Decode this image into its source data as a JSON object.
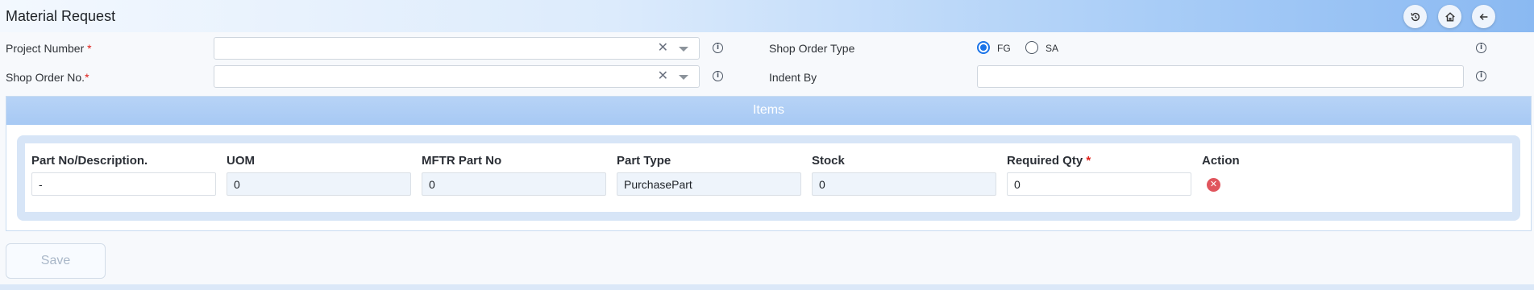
{
  "page": {
    "title": "Material Request",
    "header_icons": [
      "history-icon",
      "home-icon",
      "back-arrow-icon"
    ]
  },
  "form": {
    "project_number": {
      "label": "Project Number",
      "required_mark": "*",
      "value": ""
    },
    "shop_order_no": {
      "label": "Shop Order No.",
      "required_mark": "*",
      "value": ""
    },
    "shop_order_type": {
      "label": "Shop Order Type",
      "options": [
        {
          "label": "FG",
          "selected": true
        },
        {
          "label": "SA",
          "selected": false
        }
      ]
    },
    "indent_by": {
      "label": "Indent By",
      "value": ""
    }
  },
  "items": {
    "section_title": "Items",
    "columns": [
      {
        "label": "Part No/Description.",
        "required_mark": ""
      },
      {
        "label": "UOM",
        "required_mark": ""
      },
      {
        "label": "MFTR Part No",
        "required_mark": ""
      },
      {
        "label": "Part Type",
        "required_mark": ""
      },
      {
        "label": "Stock",
        "required_mark": ""
      },
      {
        "label": "Required Qty",
        "required_mark": "*"
      },
      {
        "label": "Action",
        "required_mark": ""
      }
    ],
    "rows": [
      {
        "part_no": "-",
        "uom": "0",
        "mftr_part_no": "0",
        "part_type": "PurchasePart",
        "stock": "0",
        "required_qty": "0",
        "action_icon": "delete-icon"
      }
    ]
  },
  "actions": {
    "save_label": "Save"
  },
  "colors": {
    "accent": "#1a73e8",
    "required": "#e0201a",
    "delete": "#e0555d",
    "items_header": "#a7c9f4"
  }
}
